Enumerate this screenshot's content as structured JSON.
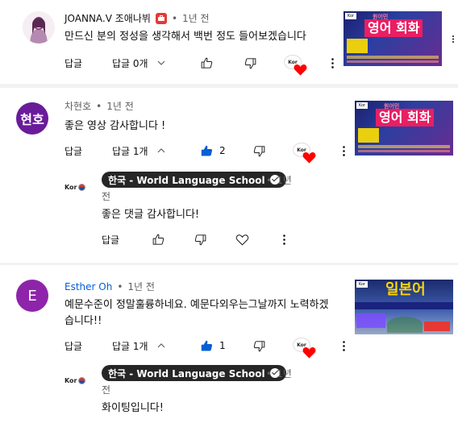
{
  "comments": [
    {
      "author": "JOANNA.V 조애나뷔",
      "time": "1년 전",
      "text": "만드신 분의 정성을 생각해서 백번 정도 들어보겠습니다",
      "reply_label": "답글",
      "replies_label": "답글 0개",
      "thumb_title": "영어 회화"
    },
    {
      "author": "차현호",
      "avatar_text": "현호",
      "time": "1년 전",
      "text": "좋은 영상 감사합니다 !",
      "reply_label": "답글",
      "replies_label": "답글 1개",
      "like_count": "2",
      "thumb_title": "영어 회화",
      "reply": {
        "author": "한국 - World Language School",
        "time_a": "1년",
        "time_b": "전",
        "text": "좋은 댓글 감사합니다!",
        "reply_label": "답글",
        "logo": "Kor"
      }
    },
    {
      "author": "Esther Oh",
      "avatar_text": "E",
      "time": "1년 전",
      "text_line1": "예문수준이 정말훌륭하네요. 예문다외우는그날까지 노력하겠",
      "text_line2": "습니다!!",
      "reply_label": "답글",
      "replies_label": "답글 1개",
      "like_count": "1",
      "thumb_title": "일본어",
      "reply": {
        "author": "한국 - World Language School",
        "time_a": "1년",
        "time_b": "전",
        "text": "화이팅입니다!",
        "logo": "Kor"
      }
    }
  ],
  "colors": {
    "accent_blue": "#065fd4",
    "avatar_purple": "#6a1b9a",
    "avatar_violet": "#8e24aa",
    "heart_red": "#ff0000"
  }
}
